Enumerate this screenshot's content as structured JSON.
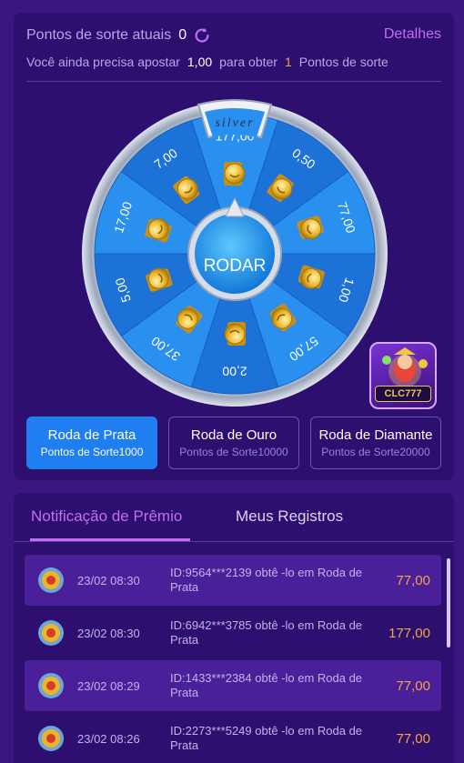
{
  "header": {
    "lucky_points_label": "Pontos de sorte atuais",
    "lucky_points_value": "0",
    "details_link": "Detalhes",
    "need_prefix": "Você ainda precisa apostar",
    "need_amount": "1,00",
    "need_mid": "para obter",
    "need_points": "1",
    "need_suffix": "Pontos de sorte"
  },
  "wheel": {
    "tier_label": "silver",
    "center_button": "RODAR",
    "segments": [
      "177,00",
      "0,50",
      "77,00",
      "1,00",
      "57,00",
      "2,00",
      "37,00",
      "5,00",
      "17,00",
      "7,00"
    ]
  },
  "badge": {
    "logo_text": "CLC777"
  },
  "wheel_tabs": [
    {
      "title": "Roda de Prata",
      "sub": "Pontos de Sorte1000"
    },
    {
      "title": "Roda de Ouro",
      "sub": "Pontos de Sorte10000"
    },
    {
      "title": "Roda de Diamante",
      "sub": "Pontos de Sorte20000"
    }
  ],
  "notif_tabs": {
    "prize": "Notificação de Prêmio",
    "records": "Meus Registros"
  },
  "records": [
    {
      "time": "23/02 08:30",
      "text": "ID:9564***2139 obtê -lo em Roda de Prata",
      "amount": "77,00"
    },
    {
      "time": "23/02 08:30",
      "text": "ID:6942***3785 obtê -lo em Roda de Prata",
      "amount": "177,00"
    },
    {
      "time": "23/02 08:29",
      "text": "ID:1433***2384 obtê -lo em Roda de Prata",
      "amount": "77,00"
    },
    {
      "time": "23/02 08:26",
      "text": "ID:2273***5249 obtê -lo em Roda de Prata",
      "amount": "77,00"
    }
  ],
  "colors": {
    "accent_purple": "#c36cf4",
    "active_blue": "#1f7ff0",
    "amount_orange": "#f3a63d"
  }
}
